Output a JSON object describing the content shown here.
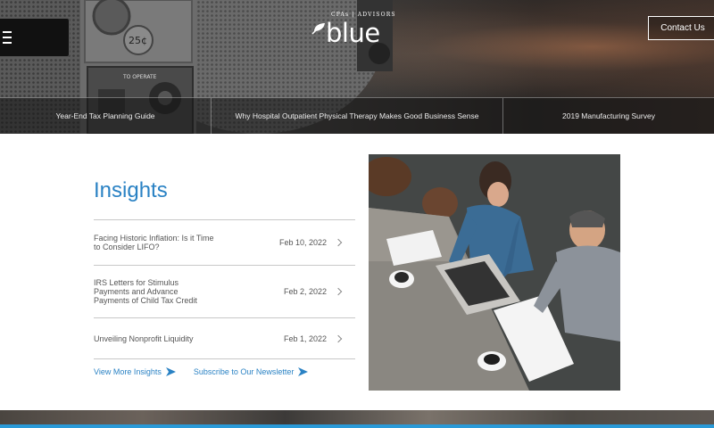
{
  "header": {
    "logo_tagline": "CPAs | ADVISORS",
    "logo_word": "blue",
    "contact_label": "Contact Us",
    "binocular_price": "25¢",
    "binocular_label": "TO OPERATE"
  },
  "ticker": [
    {
      "label": "Year-End Tax Planning Guide"
    },
    {
      "label": "Why Hospital Outpatient Physical Therapy Makes Good Business Sense"
    },
    {
      "label": "2019 Manufacturing Survey"
    }
  ],
  "insights": {
    "title": "Insights",
    "items": [
      {
        "title": "Facing Historic Inflation: Is it Time to Consider LIFO?",
        "date": "Feb 10, 2022"
      },
      {
        "title": "IRS Letters for Stimulus Payments and Advance Payments of Child Tax Credit",
        "date": "Feb 2, 2022"
      },
      {
        "title": "Unveiling Nonprofit Liquidity",
        "date": "Feb 1, 2022"
      }
    ],
    "view_more_label": "View More Insights",
    "newsletter_label": "Subscribe to Our Newsletter"
  },
  "colors": {
    "accent": "#2a82c4",
    "bottom_line": "#2a9ad8"
  }
}
